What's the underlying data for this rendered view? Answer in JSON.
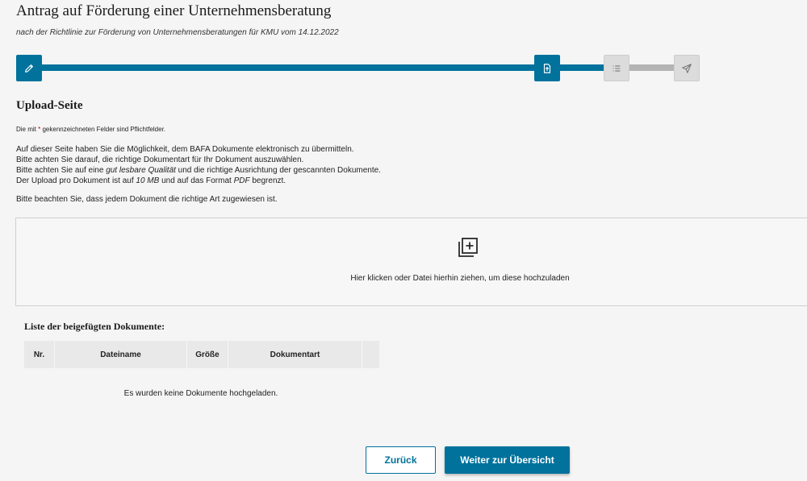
{
  "header": {
    "title": "Antrag auf Förderung einer Unternehmensberatung",
    "subtitle": "nach der Richtlinie zur Förderung von Unternehmensberatungen für KMU vom 14.12.2022"
  },
  "stepper": {
    "steps": [
      {
        "icon": "pencil-icon",
        "state": "completed"
      },
      {
        "icon": "document-upload-icon",
        "state": "current"
      },
      {
        "icon": "list-icon",
        "state": "inactive"
      },
      {
        "icon": "send-icon",
        "state": "inactive"
      }
    ],
    "colors": {
      "active": "#00729c",
      "inactive": "#b4b4b4"
    }
  },
  "section": {
    "title": "Upload-Seite",
    "required_note_before": "Die mit ",
    "required_star": "*",
    "required_note_after": " gekennzeichneten Felder sind Pflichtfelder."
  },
  "info": {
    "line1": "Auf dieser Seite haben Sie die Möglichkeit, dem BAFA Dokumente elektronisch zu übermitteln.",
    "line2": "Bitte achten Sie darauf, die richtige Dokumentart für Ihr Dokument auszuwählen.",
    "line3_a": "Bitte achten Sie auf eine ",
    "line3_em": "gut lesbare Qualität",
    "line3_b": " und die richtige Ausrichtung der gescannten Dokumente.",
    "line4_a": "Der Upload pro Dokument ist auf ",
    "line4_em1": "10 MB",
    "line4_b": " und auf das Format ",
    "line4_em2": "PDF",
    "line4_c": " begrenzt.",
    "hint": "Bitte beachten Sie, dass jedem Dokument die richtige Art zugewiesen ist."
  },
  "dropzone": {
    "icon": "add-file-icon",
    "text": "Hier klicken oder Datei hierhin ziehen, um diese hochzuladen"
  },
  "documents": {
    "title": "Liste der beigefügten Dokumente:",
    "columns": [
      "Nr.",
      "Dateiname",
      "Größe",
      "Dokumentart",
      ""
    ],
    "empty_message": "Es wurden keine Dokumente hochgeladen."
  },
  "actions": {
    "back_label": "Zurück",
    "next_label": "Weiter zur Übersicht"
  }
}
